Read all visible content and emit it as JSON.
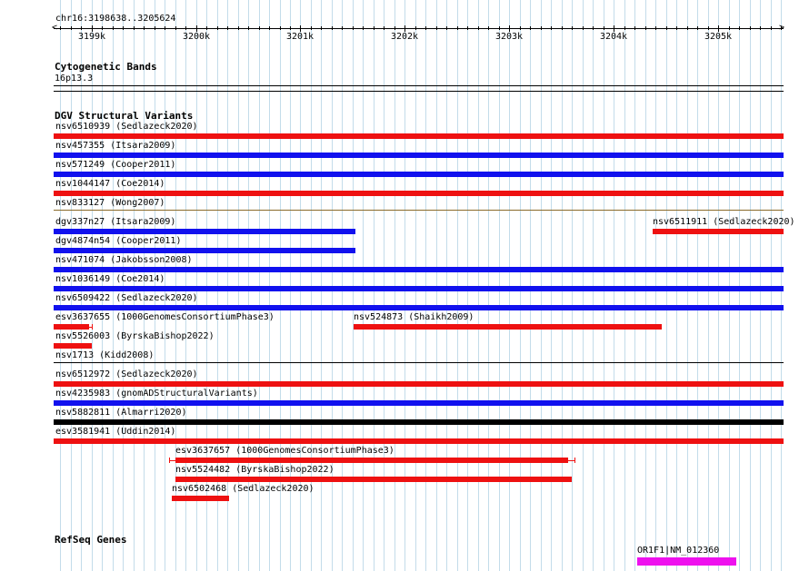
{
  "region": "chr16:3198638..3205624",
  "ruler": {
    "ticks": [
      {
        "label": "3199k",
        "value": 3199000
      },
      {
        "label": "3200k",
        "value": 3200000
      },
      {
        "label": "3201k",
        "value": 3201000
      },
      {
        "label": "3202k",
        "value": 3202000
      },
      {
        "label": "3203k",
        "value": 3203000
      },
      {
        "label": "3204k",
        "value": 3204000
      },
      {
        "label": "3205k",
        "value": 3205000
      }
    ]
  },
  "tracks": {
    "cytobands": {
      "title": "Cytogenetic Bands",
      "band": "16p13.3"
    },
    "dgv": {
      "title": "DGV Structural Variants",
      "variants": [
        {
          "label": "nsv6510939 (Sedlazeck2020)",
          "start": 3198638,
          "end": 3205624,
          "color": "#ee1111"
        },
        {
          "label": "nsv457355 (Itsara2009)",
          "start": 3198638,
          "end": 3205624,
          "color": "#1111ee"
        },
        {
          "label": "nsv571249 (Cooper2011)",
          "start": 3198638,
          "end": 3205624,
          "color": "#1111ee"
        },
        {
          "label": "nsv1044147 (Coe2014)",
          "start": 3198638,
          "end": 3205624,
          "color": "#ee1111"
        },
        {
          "label": "nsv833127 (Wong2007)",
          "start": 3198638,
          "end": 3205624,
          "color": "#8a6a2a",
          "thin": true
        },
        {
          "label": "dgv337n27 (Itsara2009)",
          "start": 3198638,
          "end": 3201530,
          "color": "#1111ee"
        },
        {
          "label": "nsv6511911 (Sedlazeck2020)",
          "start": 3204370,
          "end": 3205624,
          "color": "#ee1111"
        },
        {
          "label": "dgv4874n54 (Cooper2011)",
          "start": 3198638,
          "end": 3201530,
          "color": "#1111ee"
        },
        {
          "label": "nsv471074 (Jakobsson2008)",
          "start": 3198638,
          "end": 3205624,
          "color": "#1111ee"
        },
        {
          "label": "nsv1036149 (Coe2014)",
          "start": 3198638,
          "end": 3205624,
          "color": "#1111ee"
        },
        {
          "label": "nsv6509422 (Sedlazeck2020)",
          "start": 3198638,
          "end": 3205624,
          "color": "#1111ee"
        },
        {
          "label": "esv3637655 (1000GenomesConsortiumPhase3)",
          "start": 3198638,
          "end": 3198980,
          "color": "#ee1111",
          "whiskerEnd": 3199000
        },
        {
          "label": "nsv524873 (Shaikh2009)",
          "start": 3201510,
          "end": 3204460,
          "color": "#ee1111"
        },
        {
          "label": "nsv5526003 (ByrskaBishop2022)",
          "start": 3198638,
          "end": 3199000,
          "color": "#ee1111"
        },
        {
          "label": "nsv1713 (Kidd2008)",
          "start": 3198638,
          "end": 3205624,
          "color": "#000000",
          "thin": true
        },
        {
          "label": "nsv6512972 (Sedlazeck2020)",
          "start": 3198638,
          "end": 3205624,
          "color": "#ee1111"
        },
        {
          "label": "nsv4235983 (gnomADStructuralVariants)",
          "start": 3198638,
          "end": 3205624,
          "color": "#1111ee"
        },
        {
          "label": "nsv5882811 (Almarri2020)",
          "start": 3198638,
          "end": 3205624,
          "color": "#000000"
        },
        {
          "label": "esv3581941 (Uddin2014)",
          "start": 3198638,
          "end": 3205624,
          "color": "#ee1111"
        },
        {
          "label": "esv3637657 (1000GenomesConsortiumPhase3)",
          "start": 3199800,
          "end": 3203560,
          "color": "#ee1111",
          "whiskerStart": 3199740,
          "whiskerEnd": 3203620
        },
        {
          "label": "nsv5524482 (ByrskaBishop2022)",
          "start": 3199800,
          "end": 3203590,
          "color": "#ee1111"
        },
        {
          "label": "nsv6502468 (Sedlazeck2020)",
          "start": 3199770,
          "end": 3200320,
          "color": "#ee1111"
        }
      ]
    },
    "refseq": {
      "title": "RefSeq Genes",
      "genes": [
        {
          "label": "OR1F1|NM_012360",
          "start": 3204220,
          "end": 3205170,
          "color": "#ee11ee"
        }
      ]
    }
  }
}
